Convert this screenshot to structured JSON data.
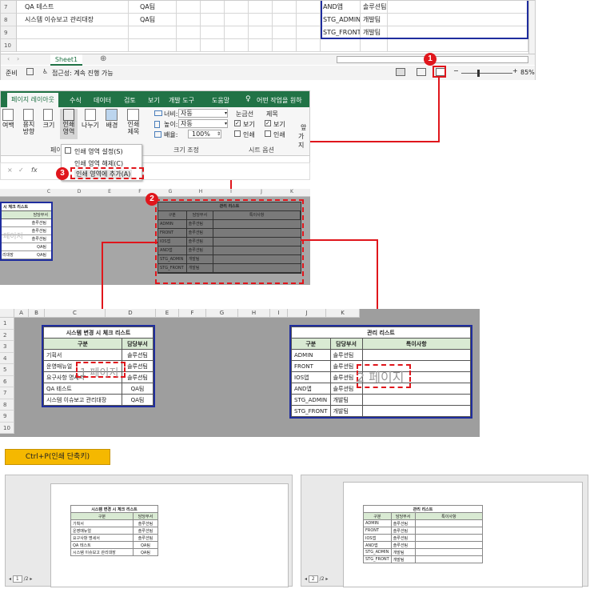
{
  "top_sheet": {
    "rows": [
      {
        "num": "7",
        "b": "QA 테스트",
        "c": "QA팀",
        "i": "AND앱",
        "j": "솔루션팀"
      },
      {
        "num": "8",
        "b": "시스템 이슈보고 관리대장",
        "c": "QA팀",
        "i": "STG_ADMIN",
        "j": "개발팀"
      },
      {
        "num": "9",
        "b": "",
        "c": "",
        "i": "STG_FRONT",
        "j": "개발팀"
      },
      {
        "num": "10",
        "b": "",
        "c": "",
        "i": "",
        "j": ""
      }
    ],
    "sheet_tab": "Sheet1",
    "add_sheet": "⊕",
    "status_ready": "준비",
    "status_accessibility": "접근성: 계속 진행 가능",
    "zoom": "85%",
    "zoom_minus": "−",
    "zoom_plus": "+"
  },
  "callouts": {
    "one": "1",
    "two": "2",
    "three": "3"
  },
  "ribbon": {
    "tabs": [
      "페이지 레이아웃",
      "수식",
      "데이터",
      "검토",
      "보기",
      "개발 도구",
      "도움말"
    ],
    "search": "어떤 작업을 원하",
    "buttons": {
      "margin": "여백",
      "orientation": "용지\n방향",
      "size": "크기",
      "print_area": "인쇄\n영역",
      "breaks": "나누기",
      "background": "배경",
      "print_titles": "인쇄\n제목"
    },
    "width_label": "너비:",
    "width_value": "자동",
    "height_label": "높이:",
    "height_value": "자동",
    "scale_label": "배율:",
    "scale_value": "100%",
    "group_page": "페이",
    "group_scale": "크기 조정",
    "group_sheet": "시트 옵션",
    "gridlines": "눈금선",
    "headings": "제목",
    "view1": "보기",
    "view2": "보기",
    "print1": "인쇄",
    "print2": "인쇄",
    "arrange": "앞",
    "arrange2": "가지"
  },
  "print_menu": {
    "set": "인쇄 영역 설정(S)",
    "clear": "인쇄 영역 해제(C)",
    "add": "인쇄 영역에 추가(A)"
  },
  "mini_left_table": {
    "title": "시 체크 리스트",
    "dept": "담당부서",
    "rows": [
      "솔루션팀",
      "솔루션팀",
      "솔루션팀",
      "QA팀",
      "QA팀"
    ],
    "watermark": "페이지",
    "last_left": "리대장"
  },
  "mini_columns": [
    "C",
    "D",
    "E",
    "F",
    "G",
    "H",
    "I",
    "J",
    "K"
  ],
  "mini_right_table": {
    "title": "관리 리스트",
    "headers": [
      "구분",
      "담당부서",
      "특이사항"
    ],
    "rows": [
      [
        "ADMIN",
        "솔루션팀"
      ],
      [
        "FRONT",
        "솔루션팀"
      ],
      [
        "IOS앱",
        "솔루션팀"
      ],
      [
        "AND앱",
        "솔루션팀"
      ],
      [
        "STG_ADMIN",
        "개발팀"
      ],
      [
        "STG_FRONT",
        "개발팀"
      ]
    ]
  },
  "grid_columns": [
    "A",
    "B",
    "C",
    "D",
    "E",
    "F",
    "G",
    "H",
    "I",
    "J",
    "K"
  ],
  "grid_rows": [
    "1",
    "2",
    "3",
    "4",
    "5",
    "6",
    "7",
    "8",
    "9",
    "10"
  ],
  "left_table": {
    "title": "시스템 변경 시 체크 리스트",
    "headers": [
      "구분",
      "담당부서"
    ],
    "rows": [
      [
        "기획서",
        "솔루션팀"
      ],
      [
        "운영매뉴얼",
        "솔루션팀"
      ],
      [
        "요구사항 명세서",
        "솔루션팀"
      ],
      [
        "QA 테스트",
        "QA팀"
      ],
      [
        "시스템 이슈보고 관리대장",
        "QA팀"
      ]
    ],
    "watermark": "1 페이지"
  },
  "right_table": {
    "title": "관리 리스트",
    "headers": [
      "구분",
      "담당부서",
      "특이사항"
    ],
    "rows": [
      [
        "ADMIN",
        "솔루션팀"
      ],
      [
        "FRONT",
        "솔루션팀"
      ],
      [
        "IOS앱",
        "솔루션팀"
      ],
      [
        "AND앱",
        "솔루션팀"
      ],
      [
        "STG_ADMIN",
        "개발팀"
      ],
      [
        "STG_FRONT",
        "개발팀"
      ]
    ],
    "watermark": "2 페이지"
  },
  "shortcut_label": "Ctrl+P(인쇄 단축키)",
  "preview": {
    "page1": {
      "current": "1",
      "total": "/2 ▸"
    },
    "page2": {
      "current": "2",
      "total": "/2 ▸"
    }
  },
  "colors": {
    "accent_red": "#e0161c",
    "table_border": "#1f2d9e",
    "ribbon_green": "#217346",
    "shortcut_bg": "#f5b800"
  }
}
